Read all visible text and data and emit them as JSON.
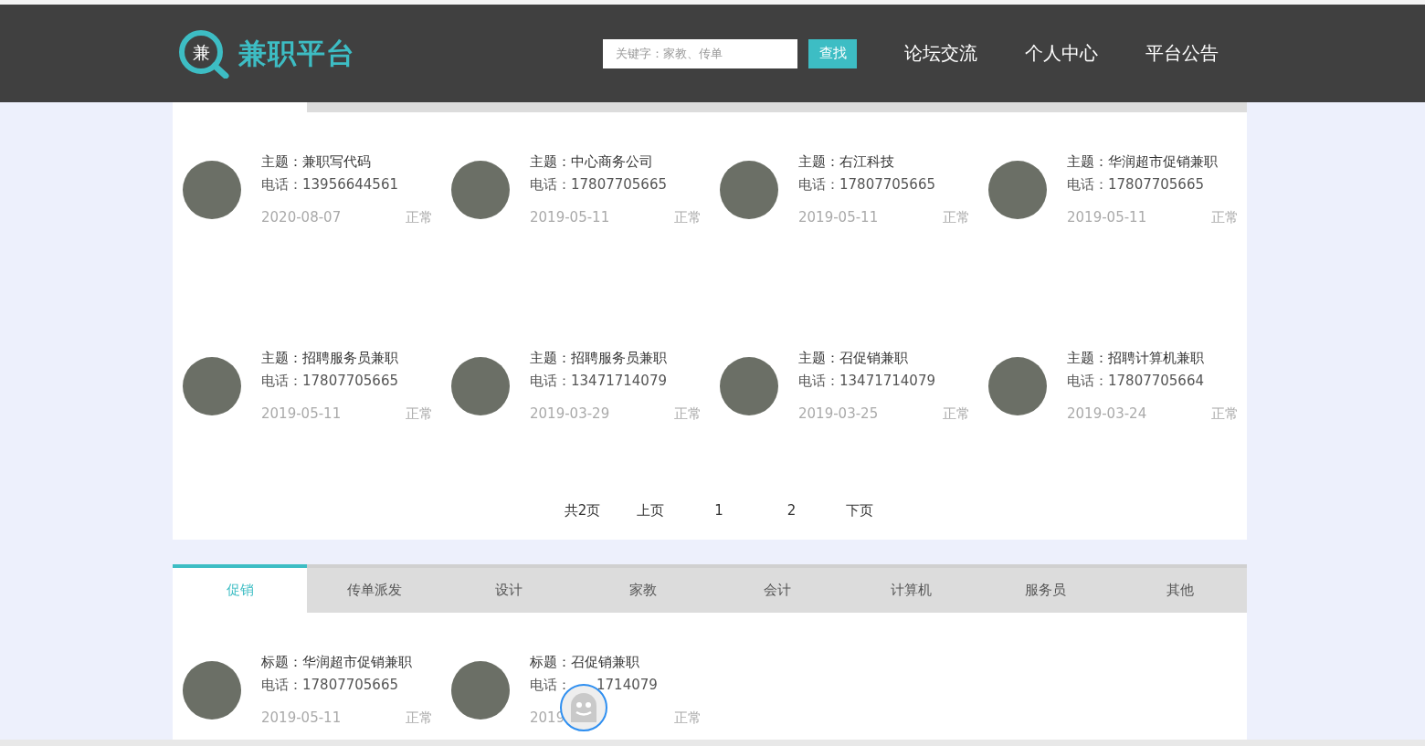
{
  "header": {
    "logo_mark": "兼",
    "logo_text": "兼职平台",
    "search": {
      "placeholder": "关键字：家教、传单",
      "button": "查找"
    },
    "nav": [
      "论坛交流",
      "个人中心",
      "平台公告"
    ]
  },
  "listing": {
    "rows": [
      [
        {
          "title": "主题：兼职写代码",
          "phone": [
            "电话：13956644561"
          ],
          "date": [
            "2020-08-07"
          ],
          "status": "正常"
        },
        {
          "title": "主题：中心商务公司",
          "phone": [
            "电话：17807705665"
          ],
          "date": [
            "2019-05-11"
          ],
          "status": "正常"
        },
        {
          "title": "主题：右江科技",
          "phone": [
            "电话：17807705665"
          ],
          "date": [
            "2019-05-11"
          ],
          "status": "正常"
        },
        {
          "title": "主题：华润超市促销兼职",
          "phone": [
            "电话：17807705665"
          ],
          "date": [
            "2019-05-11"
          ],
          "status": "正常"
        }
      ],
      [
        {
          "title": "主题：招聘服务员兼职",
          "phone": [
            "电话：17807705665"
          ],
          "date": [
            "2019-05-11"
          ],
          "status": "正常"
        },
        {
          "title": "主题：招聘服务员兼职",
          "phone": [
            "电话：13471714079"
          ],
          "date": [
            "2019-03-29"
          ],
          "status": "正常"
        },
        {
          "title": "主题：召促销兼职",
          "phone": [
            "电话：13471714079"
          ],
          "date": [
            "2019-03-25"
          ],
          "status": "正常"
        },
        {
          "title": "主题：招聘计算机兼职",
          "phone": [
            "电话：17807705664"
          ],
          "date": [
            "2019-03-24"
          ],
          "status": "正常"
        }
      ]
    ],
    "pagination": {
      "total": "共2页",
      "prev": "上页",
      "pages": [
        "1",
        "2"
      ],
      "next": "下页"
    }
  },
  "category_tabs": [
    {
      "label": "促销",
      "selected": true
    },
    {
      "label": "传单派发",
      "selected": false
    },
    {
      "label": "设计",
      "selected": false
    },
    {
      "label": "家教",
      "selected": false
    },
    {
      "label": "会计",
      "selected": false
    },
    {
      "label": "计算机",
      "selected": false
    },
    {
      "label": "服务员",
      "selected": false
    },
    {
      "label": "其他",
      "selected": false
    }
  ],
  "category_cards": [
    {
      "title": "标题：华润超市促销兼职",
      "phone": [
        "电话：17807705665"
      ],
      "date": [
        "2019-05-11"
      ],
      "status": "正常"
    },
    {
      "title": "标题：召促销兼职",
      "phone": [
        "电话：",
        "1714079"
      ],
      "date": [
        "2019"
      ],
      "status": "正常"
    }
  ]
}
